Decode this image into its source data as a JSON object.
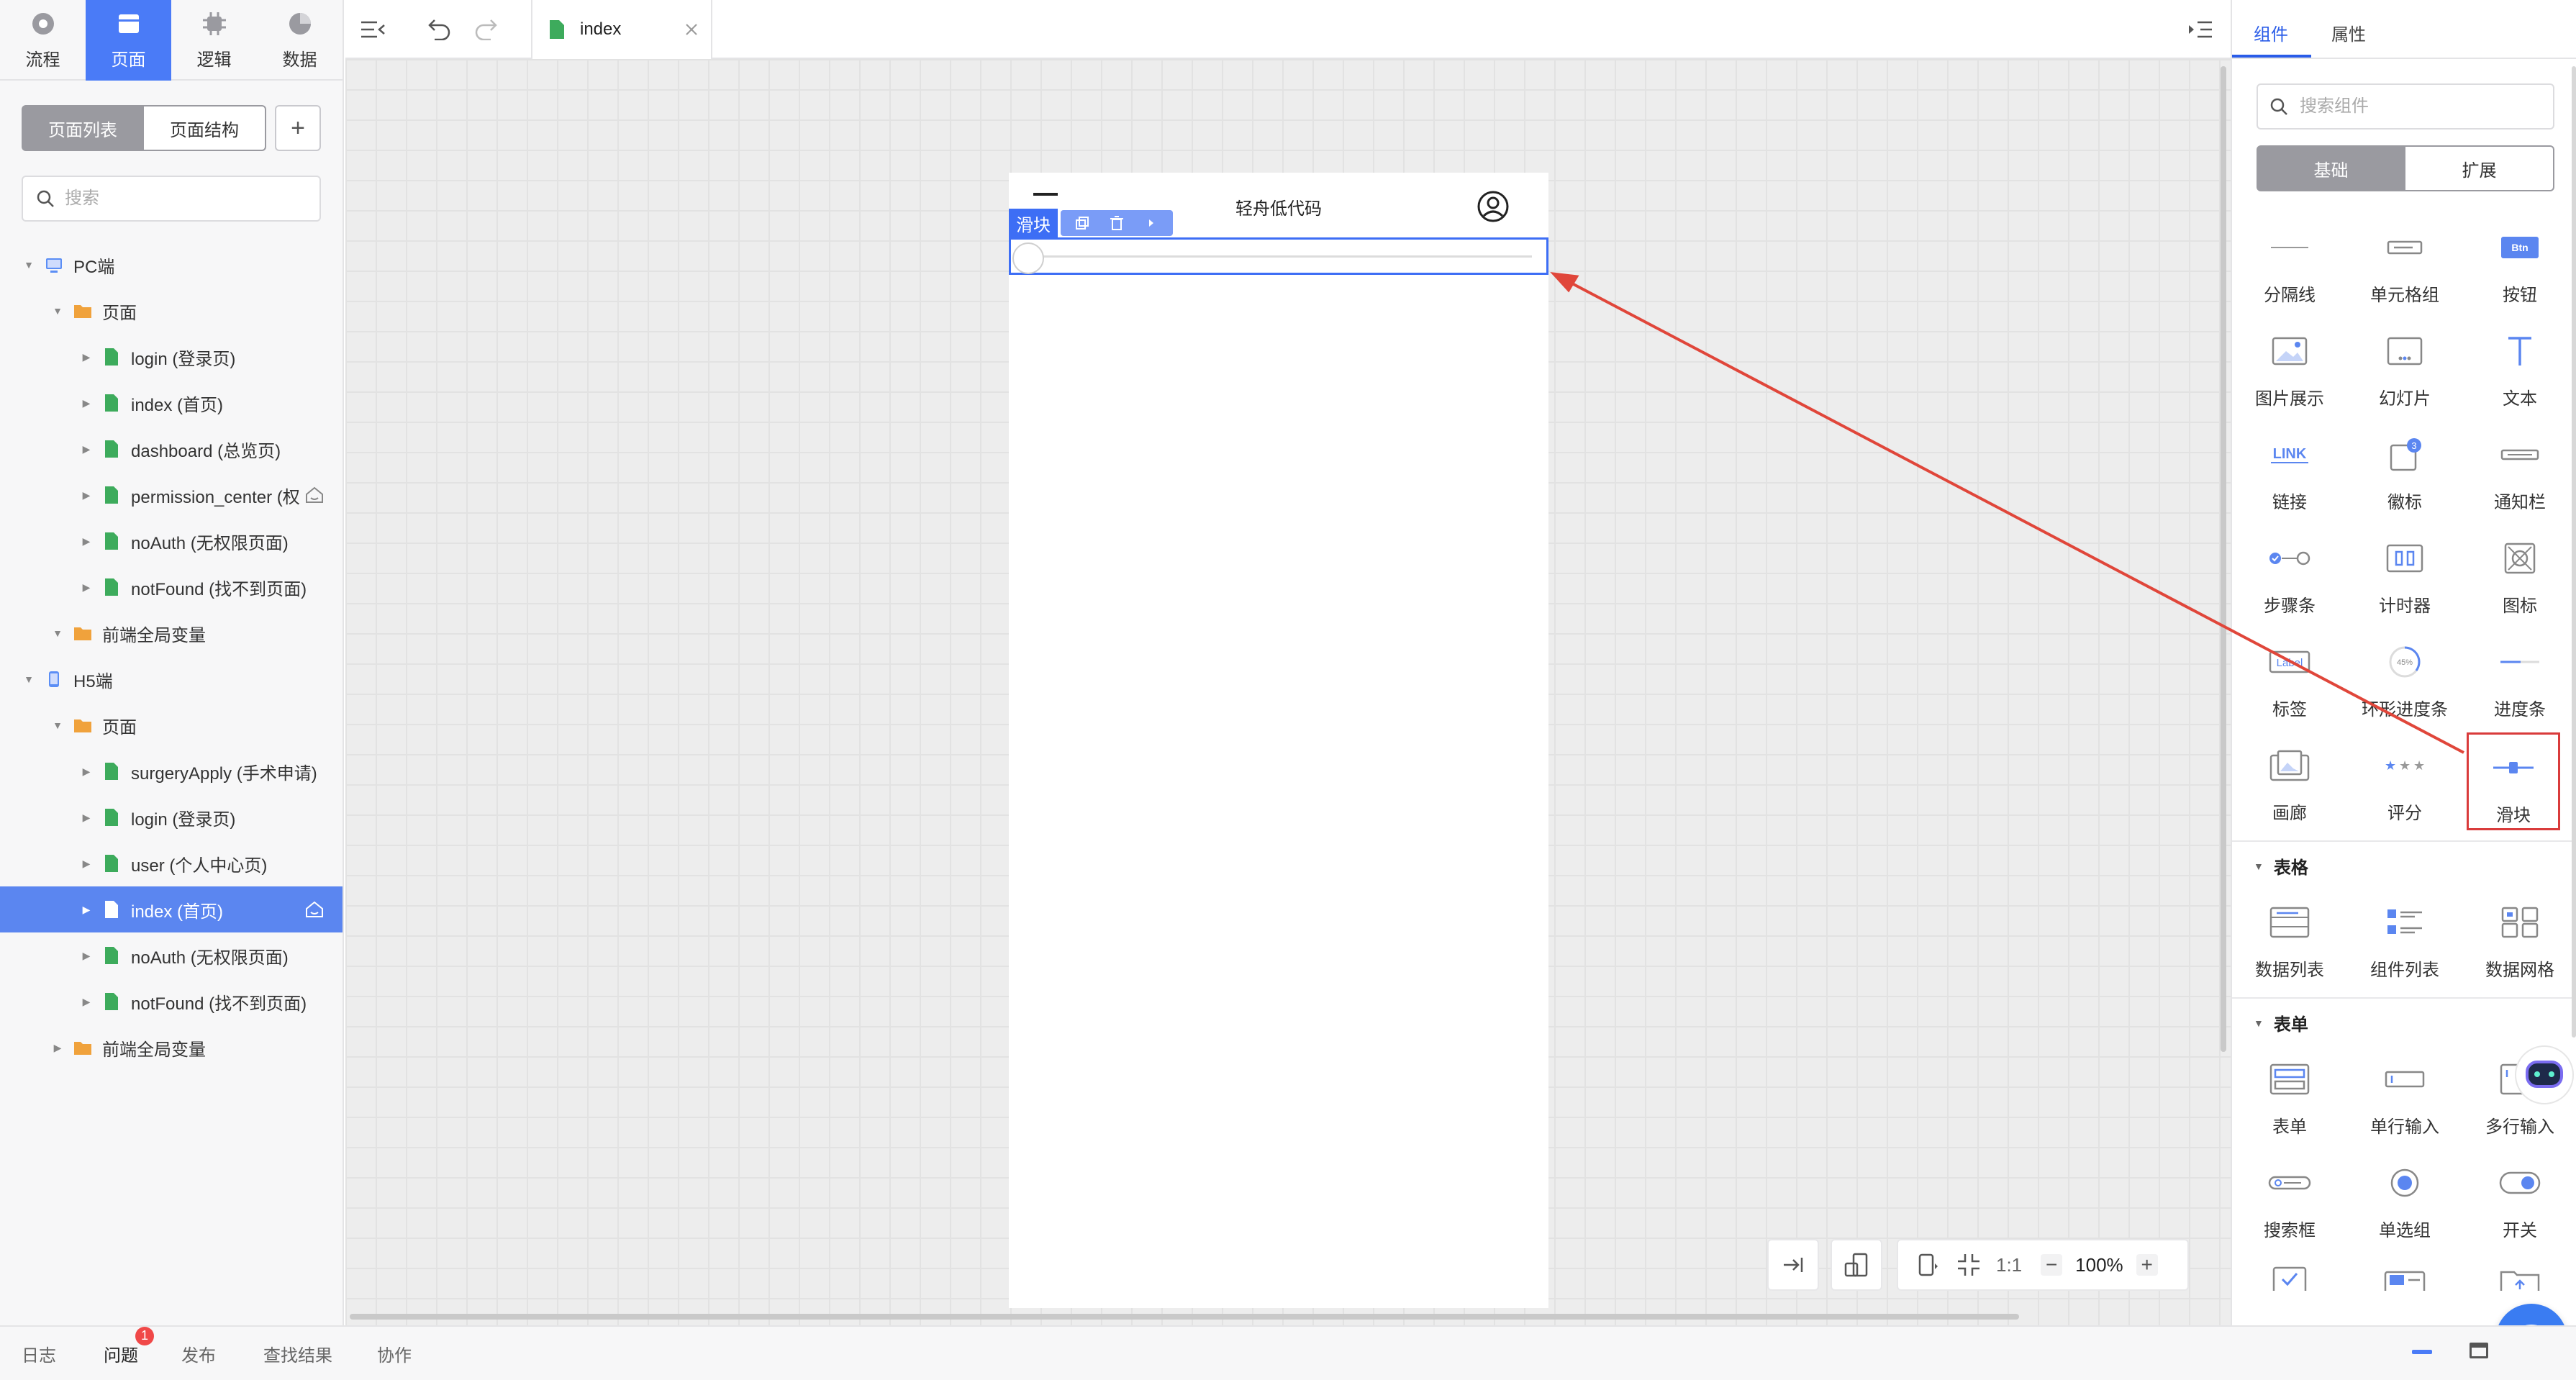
{
  "left_tabs": [
    {
      "label": "流程",
      "icon": "flow-icon"
    },
    {
      "label": "页面",
      "icon": "page-icon"
    },
    {
      "label": "逻辑",
      "icon": "logic-icon"
    },
    {
      "label": "数据",
      "icon": "data-icon"
    }
  ],
  "page_switch": {
    "list": "页面列表",
    "structure": "页面结构",
    "add": "+"
  },
  "left_search": {
    "placeholder": "搜索"
  },
  "tree": {
    "pc": "PC端",
    "pc_pages": "页面",
    "pc_items": [
      "login (登录页)",
      "index (首页)",
      "dashboard (总览页)",
      "permission_center (权",
      "noAuth (无权限页面)",
      "notFound (找不到页面)"
    ],
    "pc_global": "前端全局变量",
    "h5": "H5端",
    "h5_pages": "页面",
    "h5_items": [
      "surgeryApply (手术申请)",
      "login (登录页)",
      "user (个人中心页)",
      "index (首页)",
      "noAuth (无权限页面)",
      "notFound (找不到页面)"
    ],
    "h5_global": "前端全局变量"
  },
  "bottom_tabs": [
    "日志",
    "问题",
    "发布",
    "查找结果",
    "协作"
  ],
  "issue_badge": "1",
  "editor_tab": {
    "title": "index"
  },
  "phone": {
    "title": "轻舟低代码"
  },
  "selection": {
    "label": "滑块"
  },
  "zoom": {
    "ratio": "1:1",
    "value": "100%",
    "minus": "−",
    "plus": "+"
  },
  "right_tabs": [
    "组件",
    "属性"
  ],
  "comp_search": {
    "placeholder": "搜索组件"
  },
  "comp_switch": [
    "基础",
    "扩展"
  ],
  "basic_components": [
    "分隔线",
    "单元格组",
    "按钮",
    "图片展示",
    "幻灯片",
    "文本",
    "链接",
    "徽标",
    "通知栏",
    "步骤条",
    "计时器",
    "图标",
    "标签",
    "环形进度条",
    "进度条",
    "画廊",
    "评分",
    "滑块"
  ],
  "icon_texts": {
    "btn": "Btn",
    "link": "LINK",
    "badge_count": "3",
    "label": "Label",
    "percent": "45%"
  },
  "sections": {
    "table": "表格",
    "form": "表单"
  },
  "table_components": [
    "数据列表",
    "组件列表",
    "数据网格"
  ],
  "form_components": [
    "表单",
    "单行输入",
    "多行输入",
    "搜索框",
    "单选组",
    "开关"
  ],
  "colors": {
    "accent": "#4a7bf7",
    "selection": "#3d6ef5",
    "highlight": "#d93b3b",
    "page_icon": "#3dab5c",
    "folder": "#f0a23c"
  }
}
